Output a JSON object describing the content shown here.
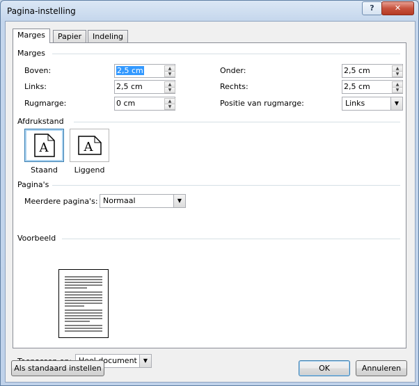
{
  "window": {
    "title": "Pagina-instelling",
    "help_label": "?",
    "close_label": "✕"
  },
  "tabs": [
    {
      "label": "Marges",
      "active": true
    },
    {
      "label": "Papier",
      "active": false
    },
    {
      "label": "Indeling",
      "active": false
    }
  ],
  "margins": {
    "group_label": "Marges",
    "top": {
      "label": "Boven:",
      "value": "2,5 cm"
    },
    "bottom": {
      "label": "Onder:",
      "value": "2,5 cm"
    },
    "left": {
      "label": "Links:",
      "value": "2,5 cm"
    },
    "right": {
      "label": "Rechts:",
      "value": "2,5 cm"
    },
    "gutter": {
      "label": "Rugmarge:",
      "value": "0 cm"
    },
    "gutter_position": {
      "label": "Positie van rugmarge:",
      "value": "Links"
    }
  },
  "orientation": {
    "group_label": "Afdrukstand",
    "portrait_label": "Staand",
    "landscape_label": "Liggend",
    "glyph": "A",
    "selected": "portrait"
  },
  "pages": {
    "group_label": "Pagina's",
    "multiple_label": "Meerdere pagina's:",
    "multiple_value": "Normaal"
  },
  "preview": {
    "group_label": "Voorbeeld"
  },
  "apply": {
    "label": "Toepassen op:",
    "value": "Heel document"
  },
  "footer": {
    "default_label": "Als standaard instellen",
    "ok_label": "OK",
    "cancel_label": "Annuleren"
  },
  "colors": {
    "selection": "#3399ff",
    "close": "#c7533e",
    "frame": "#bfd2ea"
  }
}
